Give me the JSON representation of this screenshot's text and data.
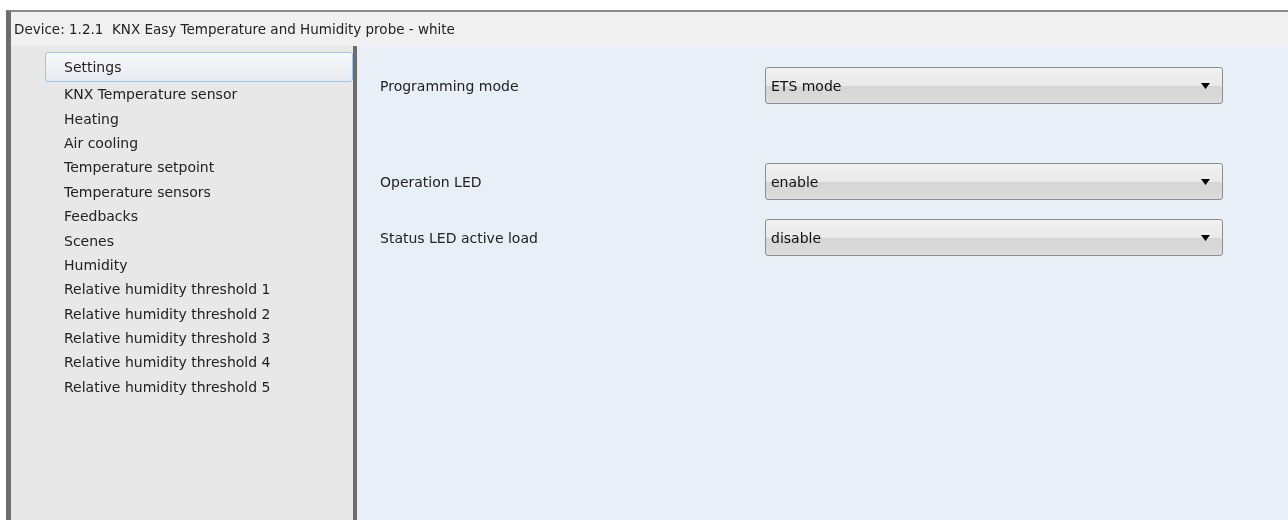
{
  "window": {
    "title": "Device: 1.2.1  KNX Easy Temperature and Humidity probe - white"
  },
  "sidebar": {
    "items": [
      {
        "label": "Settings",
        "selected": true
      },
      {
        "label": "KNX Temperature sensor",
        "selected": false
      },
      {
        "label": "Heating",
        "selected": false
      },
      {
        "label": "Air cooling",
        "selected": false
      },
      {
        "label": "Temperature setpoint",
        "selected": false
      },
      {
        "label": "Temperature sensors",
        "selected": false
      },
      {
        "label": "Feedbacks",
        "selected": false
      },
      {
        "label": "Scenes",
        "selected": false
      },
      {
        "label": "Humidity",
        "selected": false
      },
      {
        "label": "Relative humidity threshold 1",
        "selected": false
      },
      {
        "label": "Relative humidity threshold 2",
        "selected": false
      },
      {
        "label": "Relative humidity threshold 3",
        "selected": false
      },
      {
        "label": "Relative humidity threshold 4",
        "selected": false
      },
      {
        "label": "Relative humidity threshold 5",
        "selected": false
      }
    ]
  },
  "parameter_groups": [
    [
      {
        "label": "Programming mode",
        "value": "ETS mode"
      }
    ],
    [
      {
        "label": "Operation LED",
        "value": "enable"
      },
      {
        "label": "Status LED active load",
        "value": "disable"
      }
    ]
  ]
}
